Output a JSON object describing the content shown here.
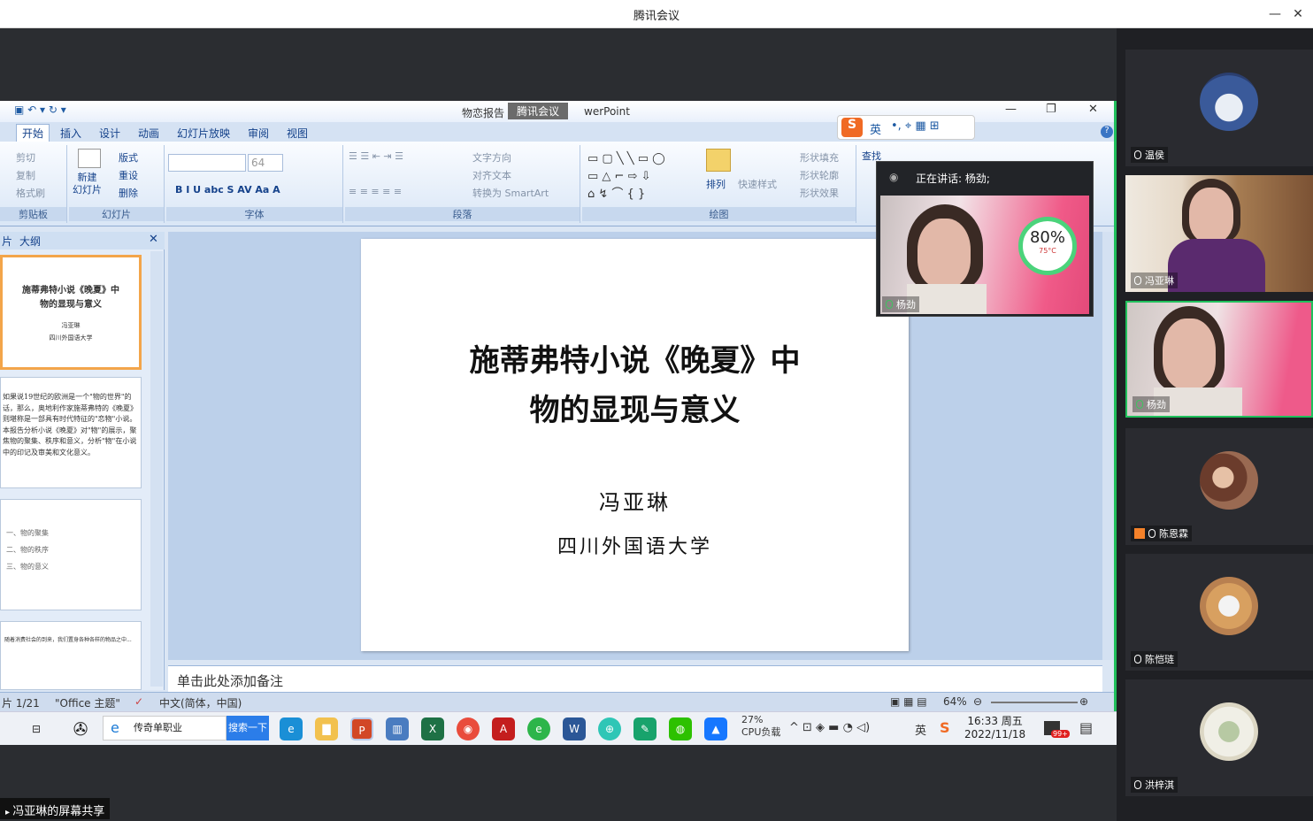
{
  "window": {
    "title": "腾讯会议"
  },
  "ppt": {
    "title_left": "物恋报告",
    "title_overlay": "腾讯会议",
    "title_right": "werPoint",
    "tabs": [
      "开始",
      "插入",
      "设计",
      "动画",
      "幻灯片放映",
      "审阅",
      "视图"
    ],
    "groups": {
      "clipboard": {
        "label": "剪贴板",
        "items": [
          "剪切",
          "复制",
          "格式刷"
        ]
      },
      "slides": {
        "label": "幻灯片",
        "new_slide": "新建\n幻灯片",
        "items": [
          "版式",
          "重设",
          "删除"
        ]
      },
      "font": {
        "label": "字体",
        "size": "64"
      },
      "paragraph": {
        "label": "段落",
        "items": [
          "文字方向",
          "对齐文本",
          "转换为 SmartArt"
        ]
      },
      "drawing": {
        "label": "绘图",
        "arrange": "排列",
        "quick_styles": "快速样式",
        "items": [
          "形状填充",
          "形状轮廓",
          "形状效果"
        ]
      },
      "editing": {
        "find": "查找"
      }
    },
    "left_tabs": [
      "片",
      "大纲"
    ],
    "thumbnails": [
      {
        "title": "施蒂弗特小说《晚夏》中\n物的显现与意义",
        "author": "冯亚琳",
        "uni": "四川外国语大学"
      },
      {
        "text": "如果说19世纪的欧洲是一个\"物的世界\"的话，那么，奥地利作家施蒂弗特的《晚夏》则堪称是一部具有时代特征的\"恋物\"小说。本报告分析小说《晚夏》对\"物\"的展示，聚焦物的聚集、秩序和意义，分析\"物\"在小说中的印记及审美和文化意义。"
      },
      {
        "items": [
          "一、物的聚集",
          "二、物的秩序",
          "三、物的意义"
        ]
      },
      {
        "text": "随着消费社会的到来，我们置身各种各样的物品之中..."
      }
    ],
    "slide": {
      "title_line1": "施蒂弗特小说《晚夏》中",
      "title_line2": "物的显现与意义",
      "author": "冯亚琳",
      "university": "四川外国语大学"
    },
    "notes_placeholder": "单击此处添加备注",
    "status": {
      "slide": "片 1/21",
      "theme": "\"Office 主题\"",
      "lang": "中文(简体，中国)",
      "zoom": "64%"
    }
  },
  "taskbar": {
    "search_text": "传奇单职业",
    "search_button": "搜索一下",
    "cpu": "27%\nCPU负载",
    "ime": "英",
    "time": "16:33 周五",
    "date": "2022/11/18",
    "badge": "99+"
  },
  "speaker_window": {
    "header": "正在讲话: 杨劲;",
    "name": "杨劲",
    "gauge_pct": "80%",
    "gauge_temp": "75°C"
  },
  "sogou": {
    "lang": "英"
  },
  "participants": [
    {
      "name": "温侯"
    },
    {
      "name": "冯亚琳"
    },
    {
      "name": "杨劲"
    },
    {
      "name": "陈恩霖"
    },
    {
      "name": "陈恺琏"
    },
    {
      "name": "洪梓淇"
    }
  ],
  "footer": {
    "label": "冯亚琳的屏幕共享"
  }
}
